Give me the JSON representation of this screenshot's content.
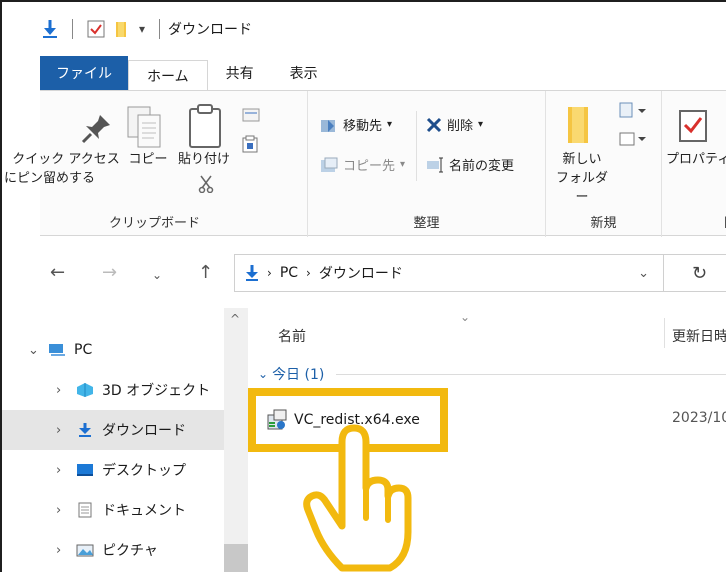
{
  "window": {
    "title": "ダウンロード"
  },
  "ribbon_tabs": [
    {
      "label": "ファイル"
    },
    {
      "label": "ホーム"
    },
    {
      "label": "共有"
    },
    {
      "label": "表示"
    }
  ],
  "ribbon": {
    "clipboard": {
      "pin_label_1": "クイック アクセス",
      "pin_label_2": "にピン留めする",
      "copy_label": "コピー",
      "paste_label": "貼り付け",
      "group_label": "クリップボード"
    },
    "organize": {
      "move_to": "移動先",
      "delete": "削除",
      "copy_to": "コピー先",
      "rename": "名前の変更",
      "group_label": "整理"
    },
    "new": {
      "new_folder_1": "新しい",
      "new_folder_2": "フォルダー",
      "group_label": "新規"
    },
    "open": {
      "properties": "プロパティ",
      "group_label": "開く"
    }
  },
  "address": {
    "crumbs": [
      "PC",
      "ダウンロード"
    ]
  },
  "nav": {
    "items": [
      {
        "label": "PC"
      },
      {
        "label": "3D オブジェクト"
      },
      {
        "label": "ダウンロード"
      },
      {
        "label": "デスクトップ"
      },
      {
        "label": "ドキュメント"
      },
      {
        "label": "ピクチャ"
      }
    ]
  },
  "list": {
    "columns": {
      "name": "名前",
      "modified": "更新日時"
    },
    "group": "今日 (1)",
    "files": [
      {
        "name": "VC_redist.x64.exe",
        "modified": "2023/10"
      }
    ]
  },
  "colors": {
    "accent": "#1c5fa8",
    "highlight": "#f2b90f",
    "selected_bg": "#e5e5e5"
  },
  "icons": [
    "download-arrow-icon",
    "pin-icon",
    "copy-icon",
    "paste-icon",
    "scissors-icon",
    "folder-icon",
    "properties-icon",
    "refresh-icon",
    "pointing-hand-icon"
  ]
}
